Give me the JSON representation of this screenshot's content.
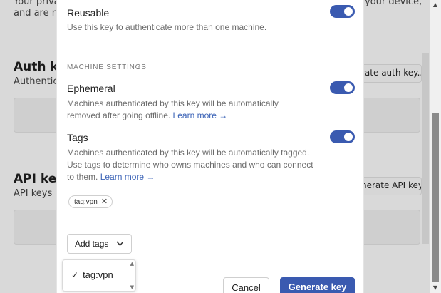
{
  "background": {
    "privacy_left": "Your priva",
    "privacy_left2": "and are ne",
    "privacy_right": "your device,",
    "auth_keys_heading": "Auth key",
    "auth_keys_sub": "Authentic",
    "generate_auth_key_button": "rate auth key...",
    "api_keys_heading": "API keys",
    "api_keys_sub": "API keys g",
    "generate_api_key_button": "nerate API key"
  },
  "modal": {
    "reusable": {
      "title": "Reusable",
      "description": "Use this key to authenticate more than one machine.",
      "enabled": true
    },
    "section_header": "MACHINE SETTINGS",
    "ephemeral": {
      "title": "Ephemeral",
      "description": "Machines authenticated by this key will be automatically removed after going offline.",
      "link": "Learn more →",
      "enabled": true
    },
    "tags": {
      "title": "Tags",
      "description": "Machines authenticated by this key will be automatically tagged. Use tags to determine who owns machines and who can connect to them.",
      "link": "Learn more →",
      "enabled": true
    },
    "selected_tags": [
      "tag:vpn"
    ],
    "add_tags_label": "Add tags",
    "dropdown_options": [
      {
        "label": "tag:vpn",
        "checked": true
      }
    ],
    "cancel_label": "Cancel",
    "generate_label": "Generate key"
  },
  "colors": {
    "accent": "#3a5ab0",
    "link": "#3a62b6"
  },
  "icons": {
    "close": "close-icon",
    "chevron": "chevron-down-icon",
    "check": "check-icon"
  }
}
